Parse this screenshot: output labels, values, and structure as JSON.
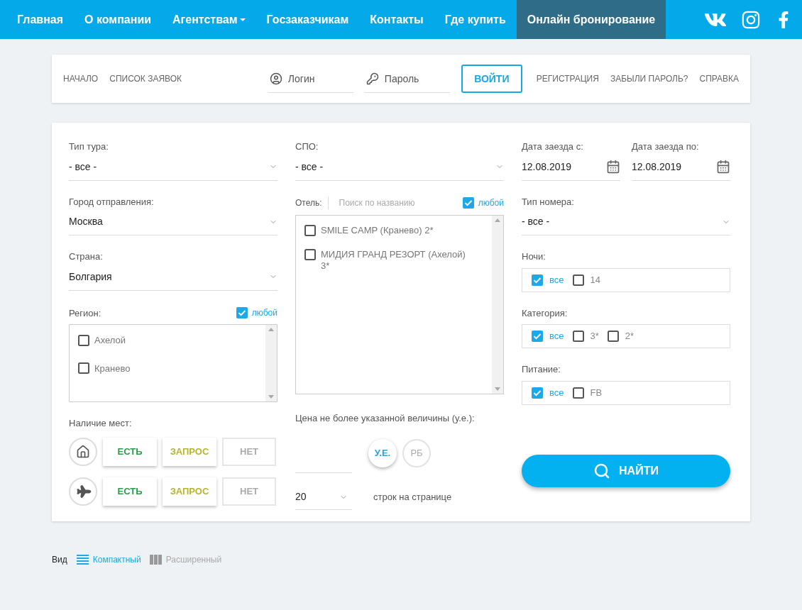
{
  "nav": {
    "items": [
      {
        "label": "Главная",
        "selected": false,
        "has_menu": false
      },
      {
        "label": "О компании",
        "selected": false,
        "has_menu": false
      },
      {
        "label": "Агентствам",
        "selected": false,
        "has_menu": true
      },
      {
        "label": "Госзаказчикам",
        "selected": false,
        "has_menu": false
      },
      {
        "label": "Контакты",
        "selected": false,
        "has_menu": false
      },
      {
        "label": "Где купить",
        "selected": false,
        "has_menu": false
      },
      {
        "label": "Онлайн бронирование",
        "selected": true,
        "has_menu": false
      }
    ],
    "social": [
      {
        "kind": "vk"
      },
      {
        "kind": "instagram"
      },
      {
        "kind": "facebook"
      }
    ]
  },
  "login_bar": {
    "left_links": [
      "НАЧАЛО",
      "СПИСОК ЗАЯВОК"
    ],
    "login": {
      "placeholder": "Логин"
    },
    "password": {
      "placeholder": "Пароль"
    },
    "submit": "ВОЙТИ",
    "right_links": [
      "РЕГИСТРАЦИЯ",
      "ЗАБЫЛИ ПАРОЛЬ?",
      "СПРАВКА"
    ]
  },
  "search": {
    "tour_type": {
      "label": "Тип тура:",
      "value": "- все -"
    },
    "departure_city": {
      "label": "Город отправления:",
      "value": "Москва"
    },
    "country": {
      "label": "Страна:",
      "value": "Болгария"
    },
    "region": {
      "label": "Регион:",
      "any": {
        "label": "любой",
        "checked": true
      },
      "items": [
        {
          "label": "Ахелой",
          "checked": false
        },
        {
          "label": "Кранево",
          "checked": false
        }
      ]
    },
    "availability": {
      "label": "Наличие мест:",
      "rows": [
        {
          "kind": "home",
          "buttons": [
            {
              "kind": "yes",
              "label": "ЕСТЬ",
              "selected": true
            },
            {
              "kind": "request",
              "label": "ЗАПРОС",
              "selected": true
            },
            {
              "kind": "no",
              "label": "НЕТ",
              "selected": false
            }
          ]
        },
        {
          "kind": "plane",
          "buttons": [
            {
              "kind": "yes",
              "label": "ЕСТЬ",
              "selected": true
            },
            {
              "kind": "request",
              "label": "ЗАПРОС",
              "selected": true
            },
            {
              "kind": "no",
              "label": "НЕТ",
              "selected": false
            }
          ]
        }
      ]
    },
    "spo": {
      "label": "СПО:",
      "value": "- все -"
    },
    "hotel": {
      "label": "Отель:",
      "search_placeholder": "Поиск по названию",
      "any": {
        "label": "любой",
        "checked": true
      },
      "items": [
        {
          "label": "SMILE CAMP (Кранево) 2*",
          "checked": false
        },
        {
          "label": "МИДИЯ ГРАНД РЕЗОРТ (Ахелой) 3*",
          "checked": false
        }
      ]
    },
    "price": {
      "label": "Цена не более указанной величины (у.е.):",
      "currencies": [
        {
          "label": "У.Е.",
          "selected": true
        },
        {
          "label": "РБ",
          "selected": false
        }
      ]
    },
    "rows_per_page": {
      "value": "20",
      "label": "строк на странице"
    },
    "date_from": {
      "label": "Дата заезда с:",
      "value": "12.08.2019"
    },
    "date_to": {
      "label": "Дата заезда по:",
      "value": "12.08.2019"
    },
    "room_type": {
      "label": "Тип номера:",
      "value": "- все -"
    },
    "check_groups": [
      {
        "label": "Ночи:",
        "options": [
          {
            "label": "все",
            "checked": true
          },
          {
            "label": "14",
            "checked": false
          }
        ]
      },
      {
        "label": "Категория:",
        "options": [
          {
            "label": "все",
            "checked": true
          },
          {
            "label": "3*",
            "checked": false
          },
          {
            "label": "2*",
            "checked": false
          }
        ]
      },
      {
        "label": "Питание:",
        "options": [
          {
            "label": "все",
            "checked": true
          },
          {
            "label": "FB",
            "checked": false
          }
        ]
      }
    ],
    "find_button": "НАЙТИ"
  },
  "view": {
    "label": "Вид",
    "options": [
      {
        "kind": "compact",
        "label": "Компактный",
        "selected": true
      },
      {
        "kind": "extended",
        "label": "Расширенный",
        "selected": false
      }
    ]
  }
}
